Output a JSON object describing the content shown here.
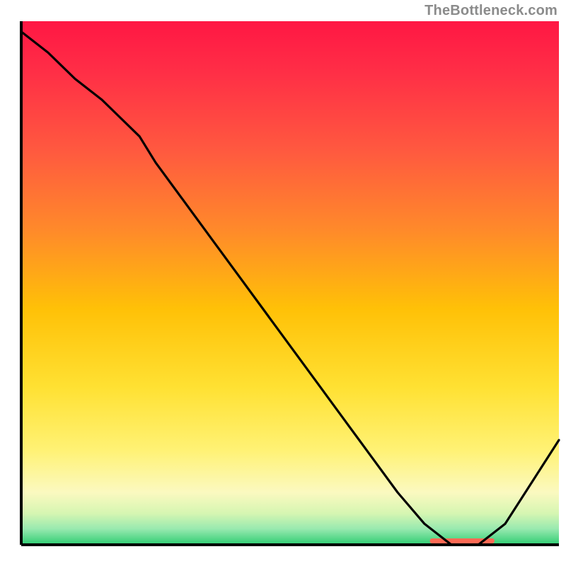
{
  "attribution": "TheBottleneck.com",
  "chart_data": {
    "type": "line",
    "title": "",
    "xlabel": "",
    "ylabel": "",
    "x_range": [
      0,
      100
    ],
    "y_range": [
      0,
      100
    ],
    "series": [
      {
        "name": "bottleneck-curve",
        "x": [
          0,
          5,
          10,
          15,
          20,
          22,
          25,
          30,
          35,
          40,
          45,
          50,
          55,
          60,
          65,
          70,
          75,
          80,
          85,
          90,
          95,
          100
        ],
        "y": [
          98,
          94,
          89,
          85,
          80,
          78,
          73,
          66,
          59,
          52,
          45,
          38,
          31,
          24,
          17,
          10,
          4,
          0,
          0,
          4,
          12,
          20
        ]
      }
    ],
    "highlight_band": {
      "x_start": 76,
      "x_end": 88,
      "color": "#ff6a55"
    },
    "background_gradient": {
      "stops": [
        {
          "offset": 0.0,
          "color": "#ff1744"
        },
        {
          "offset": 0.1,
          "color": "#ff2f46"
        },
        {
          "offset": 0.25,
          "color": "#ff5a3f"
        },
        {
          "offset": 0.4,
          "color": "#ff8a2a"
        },
        {
          "offset": 0.55,
          "color": "#ffc107"
        },
        {
          "offset": 0.7,
          "color": "#ffe133"
        },
        {
          "offset": 0.82,
          "color": "#fff275"
        },
        {
          "offset": 0.9,
          "color": "#fbf9c0"
        },
        {
          "offset": 0.94,
          "color": "#d6f6b2"
        },
        {
          "offset": 0.97,
          "color": "#97e9af"
        },
        {
          "offset": 1.0,
          "color": "#2ecc71"
        }
      ]
    }
  }
}
